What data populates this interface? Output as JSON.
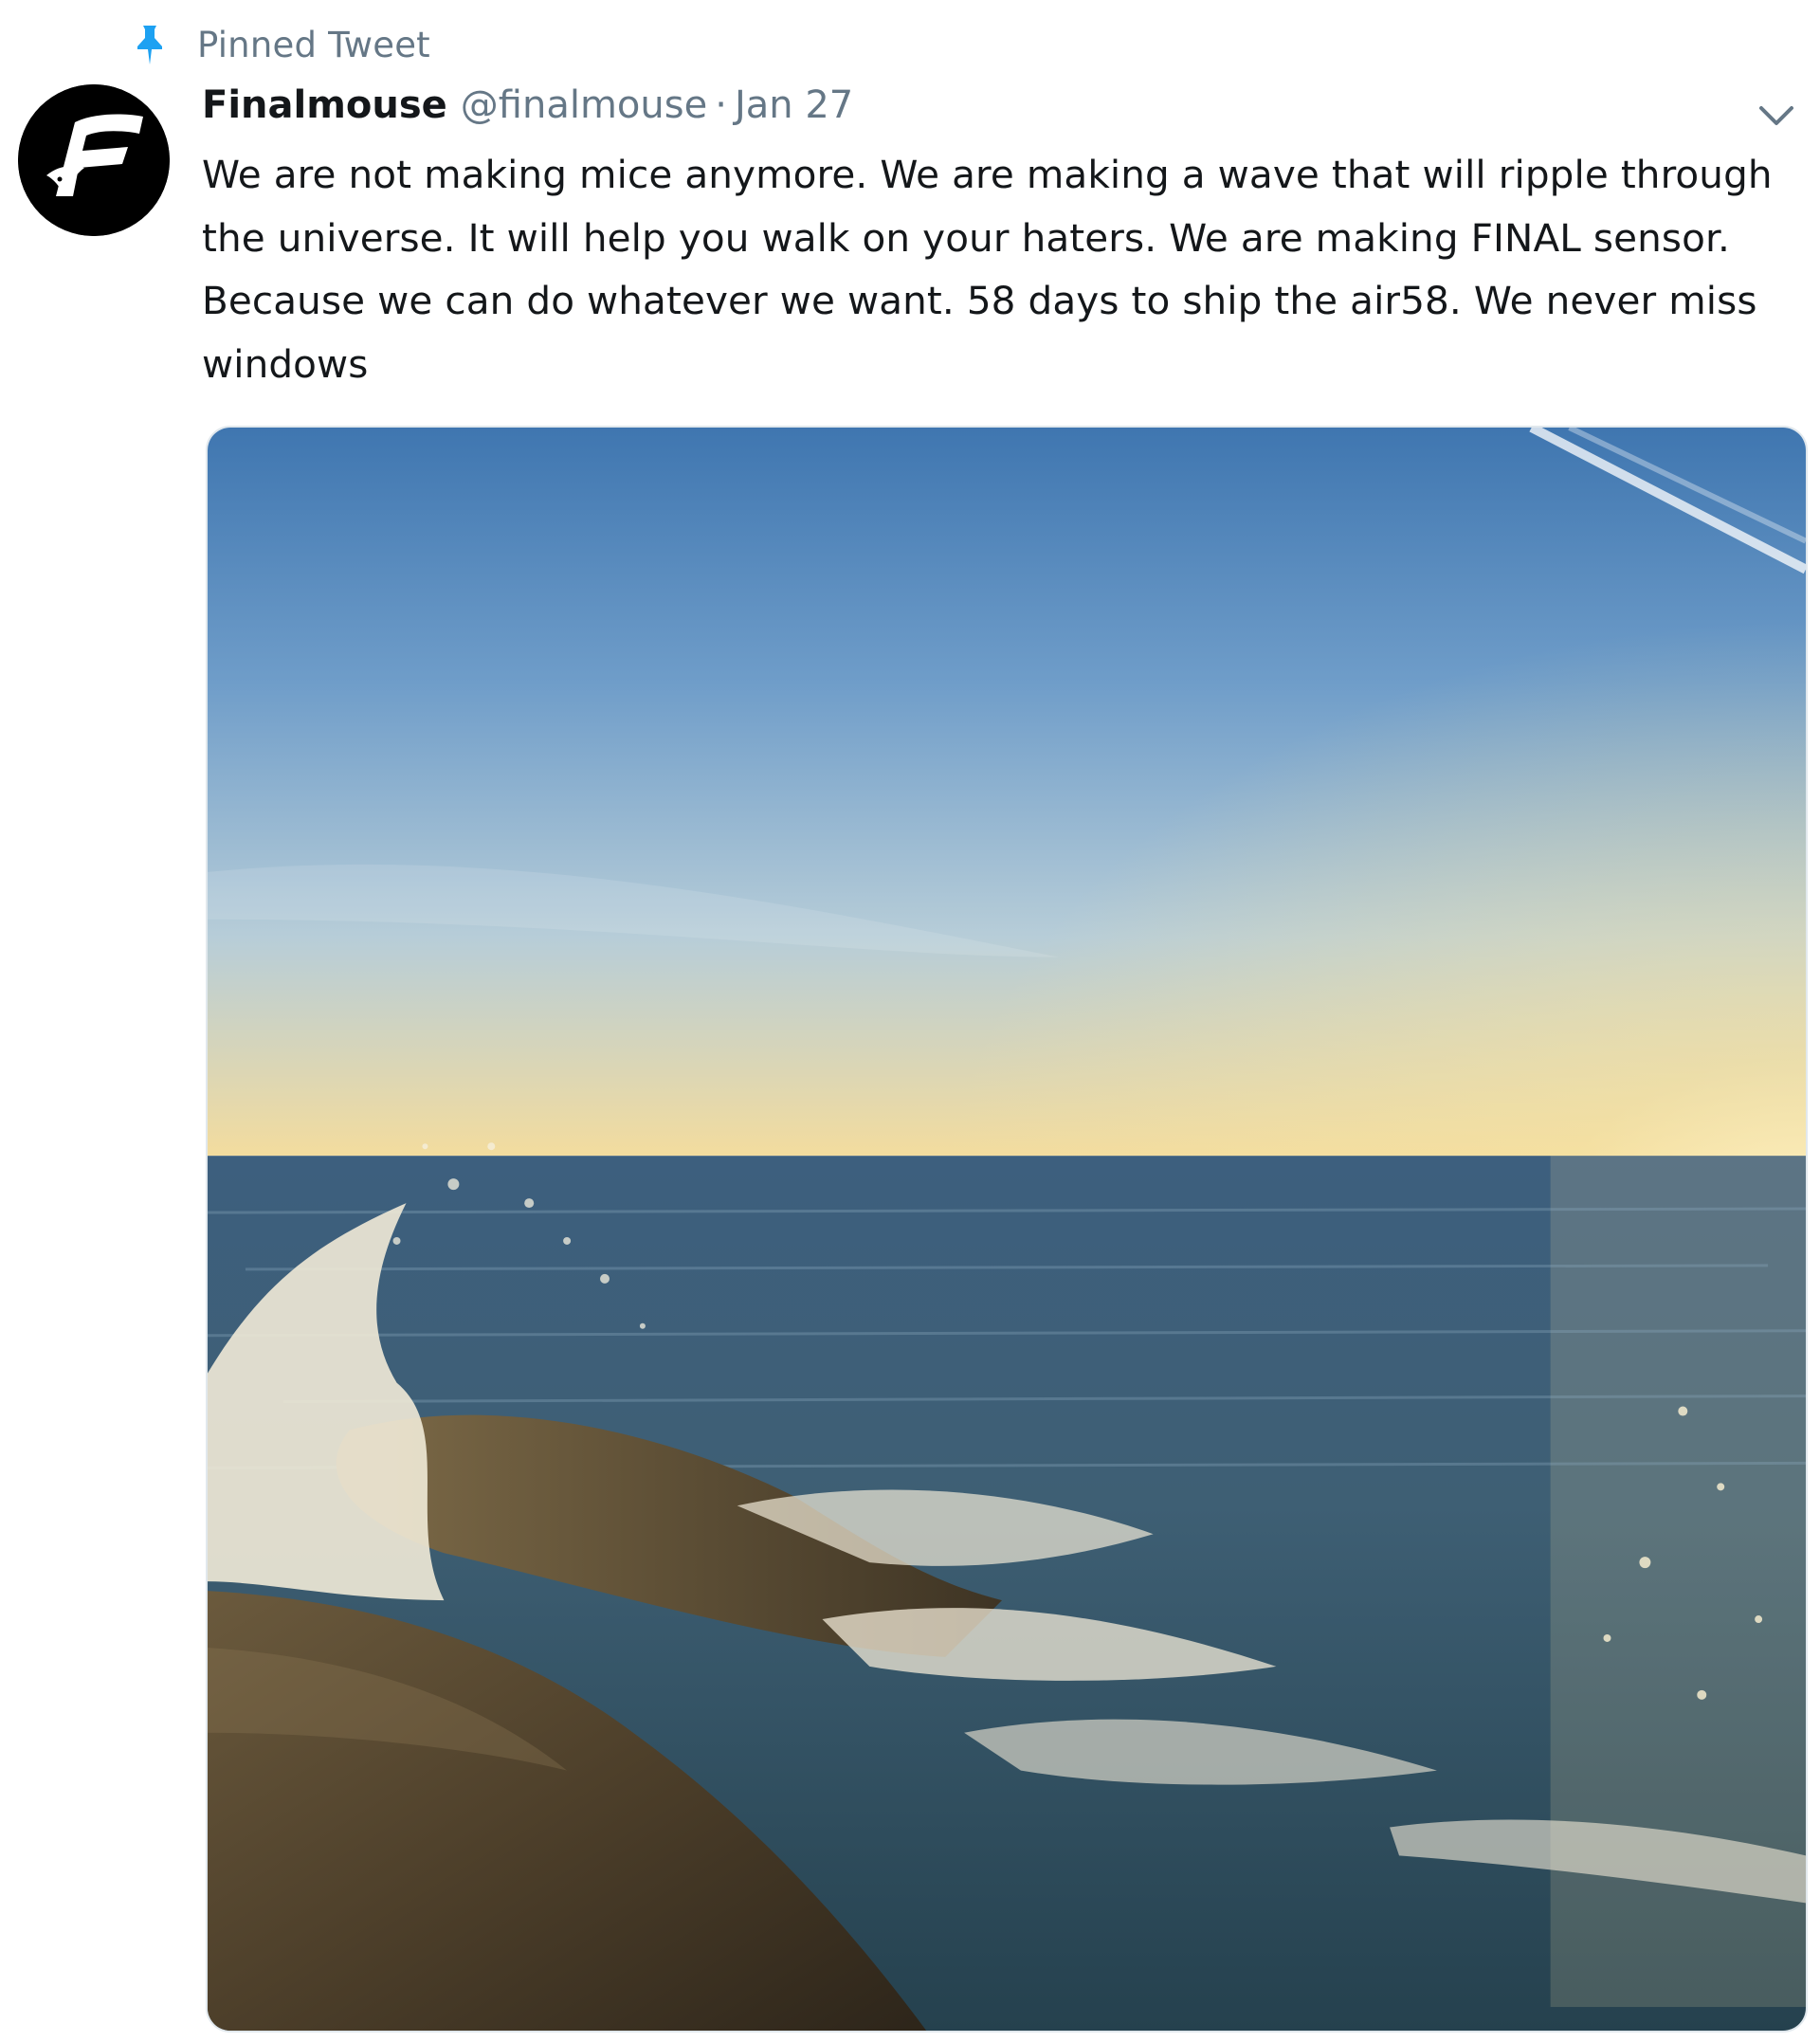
{
  "pinned": {
    "label": "Pinned Tweet",
    "icon": "pin-icon",
    "icon_color": "#1da1f2"
  },
  "tweet": {
    "author": {
      "display_name": "Finalmouse",
      "handle": "@finalmouse",
      "avatar_icon": "finalmouse-logo-icon"
    },
    "separator": "·",
    "date": "Jan 27",
    "menu_icon": "chevron-down-icon",
    "text": "We are not making mice anymore. We are making a wave that will ripple through\nthe universe. It will help you walk on your haters. We are making FINAL sensor.\nBecause we can do whatever we want. 58 days to ship the air58. We never miss\nwindows",
    "media": {
      "type": "photo",
      "icon": "ocean-photo"
    }
  },
  "colors": {
    "text_primary": "#14171a",
    "text_secondary": "#657786",
    "accent": "#1da1f2"
  }
}
